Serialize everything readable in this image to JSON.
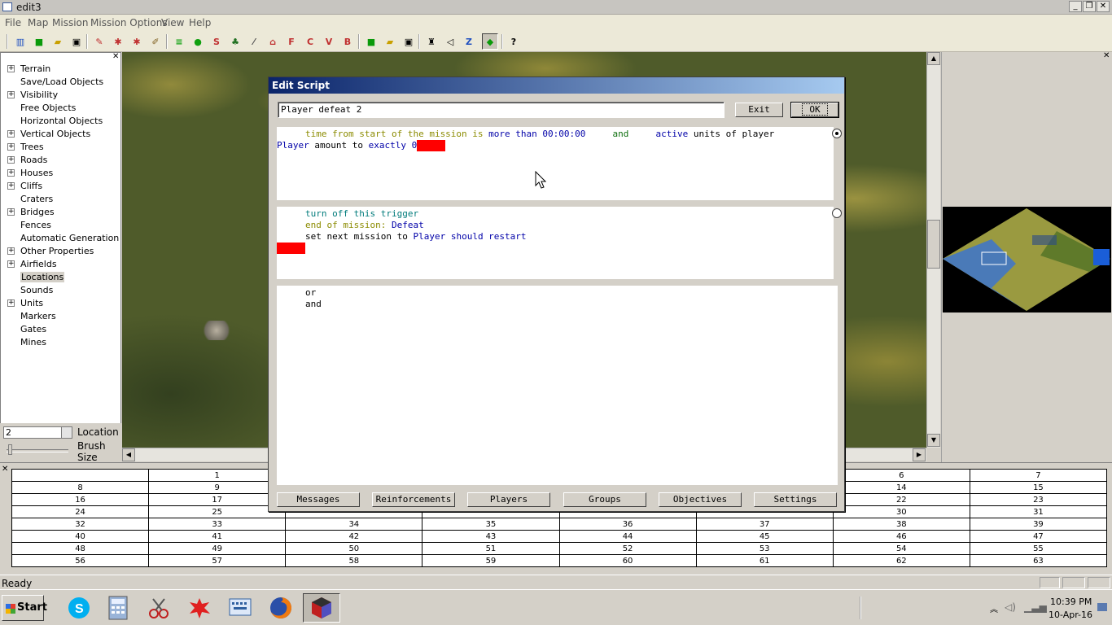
{
  "window": {
    "title": "edit3"
  },
  "menu": [
    "File",
    "Map",
    "Mission",
    "Mission Options",
    "View",
    "Help"
  ],
  "tree": [
    {
      "label": "Terrain",
      "expandable": true
    },
    {
      "label": "Save/Load Objects",
      "expandable": false
    },
    {
      "label": "Visibility",
      "expandable": true
    },
    {
      "label": "Free Objects",
      "expandable": false
    },
    {
      "label": "Horizontal Objects",
      "expandable": false
    },
    {
      "label": "Vertical Objects",
      "expandable": true
    },
    {
      "label": "Trees",
      "expandable": true
    },
    {
      "label": "Roads",
      "expandable": true
    },
    {
      "label": "Houses",
      "expandable": true
    },
    {
      "label": "Cliffs",
      "expandable": true
    },
    {
      "label": "Craters",
      "expandable": false
    },
    {
      "label": "Bridges",
      "expandable": true
    },
    {
      "label": "Fences",
      "expandable": false
    },
    {
      "label": "Automatic Generation",
      "expandable": false
    },
    {
      "label": "Other Properties",
      "expandable": true
    },
    {
      "label": "Airfields",
      "expandable": true
    },
    {
      "label": "Locations",
      "expandable": false,
      "selected": true
    },
    {
      "label": "Sounds",
      "expandable": false
    },
    {
      "label": "Units",
      "expandable": true
    },
    {
      "label": "Markers",
      "expandable": false
    },
    {
      "label": "Gates",
      "expandable": false
    },
    {
      "label": "Mines",
      "expandable": false
    }
  ],
  "location_panel": {
    "value": "2",
    "location_label": "Location",
    "brush_label": "Brush Size"
  },
  "dialog": {
    "title": "Edit Script",
    "name": "Player defeat 2",
    "exit_label": "Exit",
    "ok_label": "OK",
    "conditions": {
      "t1": "time from start of the mission is",
      "t2": "more than",
      "t3": "00:00:00",
      "t4": "and",
      "t5": "active",
      "t6": "units of player",
      "t7": "Player",
      "t8": "amount to",
      "t9": "exactly",
      "t10": "0"
    },
    "actions": {
      "a1": "turn off this trigger",
      "a2": "end of mission:",
      "a3": "Defeat",
      "a4": "set next mission to",
      "a5": "Player should restart"
    },
    "logic": {
      "or": "or",
      "and": "and"
    },
    "footer_buttons": [
      "Messages",
      "Reinforcements",
      "Players",
      "Groups",
      "Objectives",
      "Settings"
    ]
  },
  "grid": {
    "rows": [
      [
        "",
        "1",
        "",
        "",
        "",
        "",
        "6",
        "7"
      ],
      [
        "8",
        "9",
        "",
        "",
        "",
        "",
        "14",
        "15"
      ],
      [
        "16",
        "17",
        "",
        "",
        "",
        "",
        "22",
        "23"
      ],
      [
        "24",
        "25",
        "",
        "",
        "",
        "",
        "30",
        "31"
      ],
      [
        "32",
        "33",
        "34",
        "35",
        "36",
        "37",
        "38",
        "39"
      ],
      [
        "40",
        "41",
        "42",
        "43",
        "44",
        "45",
        "46",
        "47"
      ],
      [
        "48",
        "49",
        "50",
        "51",
        "52",
        "53",
        "54",
        "55"
      ],
      [
        "56",
        "57",
        "58",
        "59",
        "60",
        "61",
        "62",
        "63"
      ]
    ]
  },
  "status": {
    "text": "Ready"
  },
  "taskbar": {
    "start_label": "Start",
    "time": "10:39 PM",
    "date": "10-Apr-16"
  },
  "colors": {
    "title_gradient_start": "#0a246a",
    "title_gradient_end": "#a6caf0",
    "marker_red": "#ff0000"
  }
}
